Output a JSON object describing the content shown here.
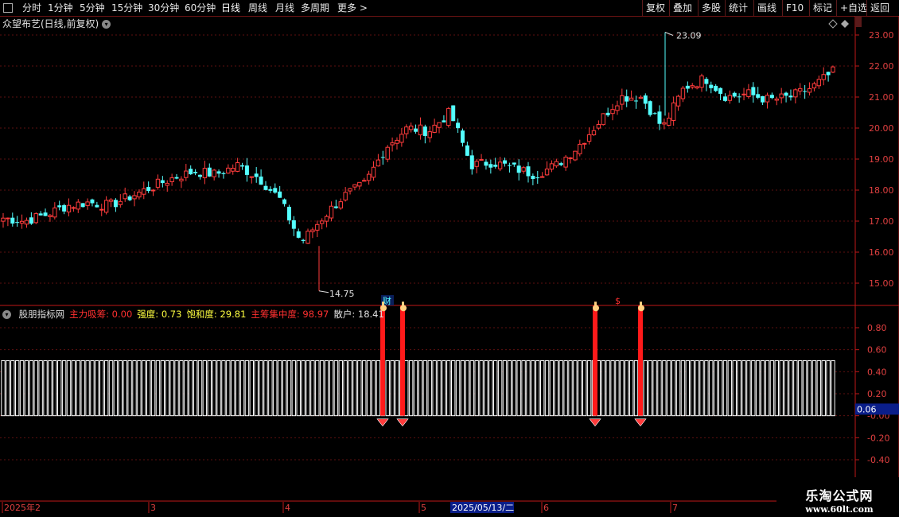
{
  "toolbar": {
    "left": [
      "分时",
      "1分钟",
      "5分钟",
      "15分钟",
      "30分钟",
      "60分钟",
      "日线",
      "周线",
      "月线",
      "多周期",
      "更多 >"
    ],
    "right": [
      "复权",
      "叠加",
      "多股",
      "统计",
      "画线",
      "F10",
      "标记",
      "+自选",
      "返回"
    ],
    "active": "日线"
  },
  "stock": {
    "title": "众望布艺(日线,前复权)",
    "high_label": "23.09",
    "low_label": "14.75",
    "marker_cai": "财",
    "marker_dollar": "$"
  },
  "price_axis": [
    "23.00",
    "22.00",
    "21.00",
    "20.00",
    "19.00",
    "18.00",
    "17.00",
    "16.00",
    "15.00"
  ],
  "indicator": {
    "name": "股朋指标网",
    "fields": [
      {
        "label": "主力吸筹:",
        "value": "0.00",
        "color": "#ff3030"
      },
      {
        "label": "强度:",
        "value": "0.73",
        "color": "#ffff40"
      },
      {
        "label": "饱和度:",
        "value": "29.81",
        "color": "#ffff40"
      },
      {
        "label": "主筹集中度:",
        "value": "98.97",
        "color": "#ff3030"
      },
      {
        "label": "散户:",
        "value": "18.41",
        "color": "#e0e0e0"
      }
    ],
    "axis": [
      "0.80",
      "0.60",
      "0.40",
      "0.20",
      "-0.00",
      "-0.20",
      "-0.40"
    ],
    "current_value": "0.06"
  },
  "date_axis": {
    "labels": [
      "2025年2",
      "3",
      "4",
      "5",
      "6",
      "7"
    ],
    "highlight": "2025/05/13/二"
  },
  "watermark": {
    "line1": "乐淘公式网",
    "line2": "www.60lt.com"
  },
  "chart_data": {
    "type": "candlestick",
    "title": "众望布艺(日线,前复权)",
    "price_range": [
      14.6,
      23.4
    ],
    "high": 23.09,
    "low": 14.75,
    "approx_closes": [
      17.1,
      17.0,
      17.2,
      17.5,
      17.6,
      17.5,
      17.8,
      18.1,
      18.4,
      18.6,
      18.5,
      18.8,
      18.4,
      17.7,
      16.3,
      17.1,
      17.8,
      18.2,
      19.4,
      20.0,
      19.9,
      20.5,
      18.8,
      18.9,
      18.7,
      18.5,
      18.8,
      19.4,
      20.2,
      21.0,
      21.0,
      20.0,
      21.3,
      21.6,
      21.0,
      21.1,
      20.9,
      21.0,
      21.3,
      21.8
    ],
    "signals": {
      "count": 4,
      "value": 1.0
    },
    "indicator_base": 0.5
  }
}
